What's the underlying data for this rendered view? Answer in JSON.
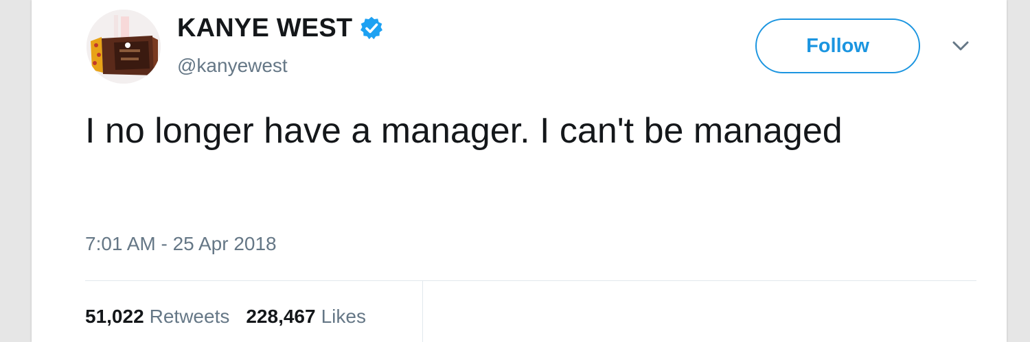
{
  "colors": {
    "accent": "#1b95e0",
    "verified": "#1da1f2",
    "text": "#14171a",
    "secondary": "#657786",
    "divider": "#e1e8ed"
  },
  "user": {
    "name": "KANYE WEST",
    "handle": "@kanyewest",
    "verified_icon": "verified-badge-icon",
    "avatar_icon": "profile-avatar"
  },
  "follow": {
    "label": "Follow"
  },
  "menu": {
    "icon": "chevron-down-icon"
  },
  "tweet": {
    "text": "I no longer have a manager. I can't be managed",
    "timestamp": "7:01 AM - 25 Apr 2018"
  },
  "stats": {
    "retweets_count": "51,022",
    "retweets_label": "Retweets",
    "likes_count": "228,467",
    "likes_label": "Likes"
  }
}
